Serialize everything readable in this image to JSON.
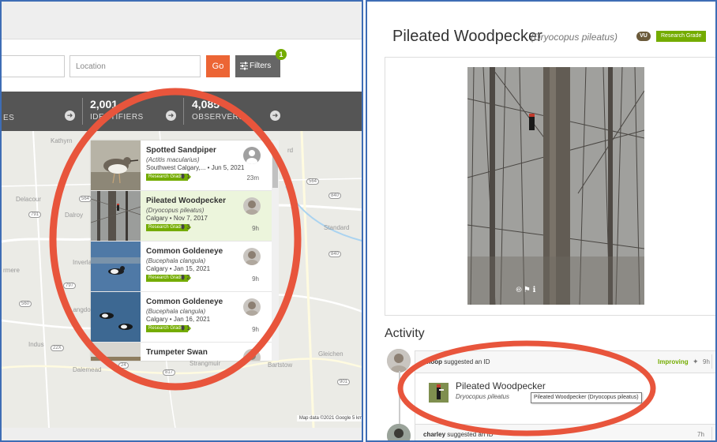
{
  "left": {
    "search": {
      "location_placeholder": "Location",
      "go_label": "Go",
      "filters_label": "Filters",
      "filters_count": "1"
    },
    "stats": {
      "partial_label": "ES",
      "identifiers_count": "2,001",
      "identifiers_label": "IDENTIFIERS",
      "observers_count": "4,085",
      "observers_label": "OBSERVERS",
      "arrow_glyph": "➜"
    },
    "map": {
      "labels": [
        "Kathyrn",
        "Delacour",
        "Dalroy",
        "Inverla",
        "rmere",
        "Langdon",
        "Indus",
        "Dalemead",
        "Strangmuir",
        "Standard",
        "Gleichen",
        "Bartstow",
        "rd"
      ],
      "shields": [
        "564",
        "791",
        "797",
        "560",
        "22X",
        "817",
        "564",
        "840",
        "840",
        "901",
        "24"
      ],
      "credit": "Map data ©2021 Google",
      "scale": "5 km"
    },
    "observations": [
      {
        "common": "Spotted Sandpiper",
        "scientific": "(Actitis macularius)",
        "meta": "Southwest Calgary,... • Jun 5, 2021",
        "grade": "Research Grade",
        "ids": "1",
        "time": "23m"
      },
      {
        "common": "Pileated Woodpecker",
        "scientific": "(Dryocopus pileatus)",
        "meta": "Calgary • Nov 7, 2017",
        "grade": "Research Grade",
        "ids": "3",
        "time": "9h"
      },
      {
        "common": "Common Goldeneye",
        "scientific": "(Bucephala clangula)",
        "meta": "Calgary • Jan 15, 2021",
        "grade": "Research Grade",
        "ids": "2",
        "time": "9h"
      },
      {
        "common": "Common Goldeneye",
        "scientific": "(Bucephala clangula)",
        "meta": "Calgary • Jan 16, 2021",
        "grade": "Research Grade",
        "ids": "1",
        "time": "9h"
      },
      {
        "common": "Trumpeter Swan",
        "scientific": "",
        "meta": "",
        "grade": "",
        "ids": "",
        "time": ""
      }
    ]
  },
  "right": {
    "title_common": "Pileated Woodpecker",
    "title_scientific": "(Dryocopus pileatus)",
    "status_badge": "VU",
    "grade_badge": "Research Grade",
    "photo_icons": "🅭 ⚑ ℹ",
    "activity_heading": "Activity",
    "activity": [
      {
        "user": "khoop",
        "action": " suggested an ID",
        "status": "Improving",
        "time": "9h",
        "taxon_common": "Pileated Woodpecker",
        "taxon_scientific": "Dryocopus pileatus",
        "tooltip": "Pileated Woodpecker (Dryocopus pileatus)"
      },
      {
        "user": "charley",
        "action": " suggested an ID",
        "time": "7h"
      }
    ],
    "chevron": "⌄"
  },
  "colors": {
    "annotation_ellipse": "#e8553c",
    "panel_border": "#3e6db5",
    "research_grade": "#74ac00",
    "go_button": "#ec6535"
  }
}
